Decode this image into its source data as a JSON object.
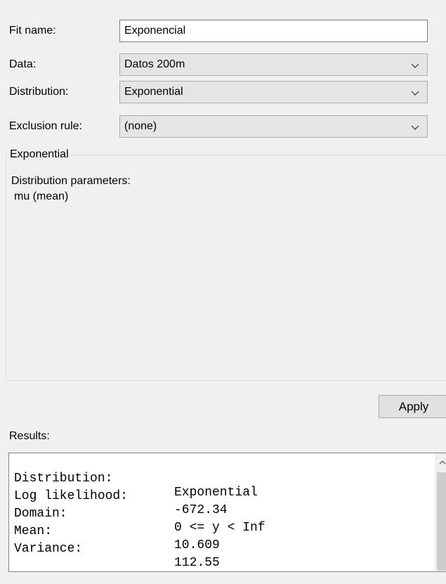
{
  "form": {
    "fit_name": {
      "label": "Fit name:",
      "value": "Exponencial"
    },
    "data": {
      "label": "Data:",
      "value": "Datos 200m"
    },
    "distribution": {
      "label": "Distribution:",
      "value": "Exponential"
    },
    "exclusion_rule": {
      "label": "Exclusion rule:",
      "value": "(none)"
    }
  },
  "group": {
    "title": "Exponential",
    "params_title": "Distribution parameters:",
    "params": [
      "mu (mean)"
    ]
  },
  "apply_label": "Apply",
  "results": {
    "label": "Results:",
    "lines": [
      {
        "key": "Distribution:",
        "value": "Exponential"
      },
      {
        "key": "Log likelihood:",
        "value": "-672.34"
      },
      {
        "key": "Domain:",
        "value": "0 <= y < Inf"
      },
      {
        "key": "Mean:",
        "value": "10.609"
      },
      {
        "key": "Variance:",
        "value": "112.55"
      }
    ]
  },
  "icons": {
    "dropdown": "chevron-down-icon",
    "scroll_up": "scroll-up-arrow-icon"
  }
}
